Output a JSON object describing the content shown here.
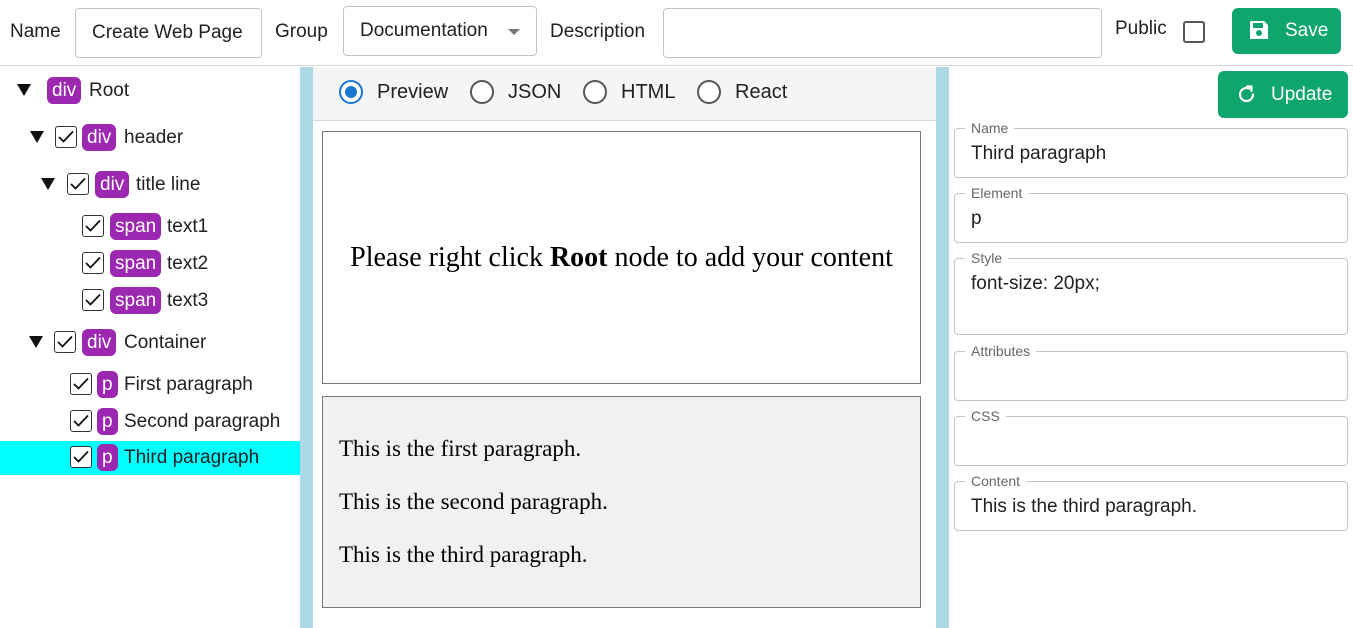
{
  "toolbar": {
    "name_label": "Name",
    "name_value": "Create Web Page",
    "group_label": "Group",
    "group_value": "Documentation",
    "description_label": "Description",
    "description_value": "",
    "public_label": "Public",
    "public_checked": false,
    "save_label": "Save"
  },
  "tree": {
    "nodes": [
      {
        "tag": "div",
        "label": "Root",
        "expanded": true,
        "checkbox": false
      },
      {
        "tag": "div",
        "label": "header",
        "expanded": true,
        "checked": true
      },
      {
        "tag": "div",
        "label": "title line",
        "expanded": true,
        "checked": true
      },
      {
        "tag": "span",
        "label": "text1",
        "checked": true
      },
      {
        "tag": "span",
        "label": "text2",
        "checked": true
      },
      {
        "tag": "span",
        "label": "text3",
        "checked": true
      },
      {
        "tag": "div",
        "label": "Container",
        "expanded": true,
        "checked": true
      },
      {
        "tag": "p",
        "label": "First paragraph",
        "checked": true
      },
      {
        "tag": "p",
        "label": "Second paragraph",
        "checked": true
      },
      {
        "tag": "p",
        "label": "Third paragraph",
        "checked": true,
        "selected": true
      }
    ]
  },
  "view_modes": {
    "options": [
      "Preview",
      "JSON",
      "HTML",
      "React"
    ],
    "selected": "Preview"
  },
  "preview": {
    "hint_before": "Please right click ",
    "hint_bold": "Root",
    "hint_after": " node to add your content",
    "paragraphs": [
      "This is the first paragraph.",
      "This is the second paragraph.",
      "This is the third paragraph."
    ]
  },
  "properties": {
    "update_label": "Update",
    "name_label": "Name",
    "name_value": "Third paragraph",
    "element_label": "Element",
    "element_value": "p",
    "style_label": "Style",
    "style_value": "font-size: 20px;",
    "attributes_label": "Attributes",
    "attributes_value": "",
    "css_label": "CSS",
    "css_value": "",
    "content_label": "Content",
    "content_value": "This is the third paragraph."
  },
  "colors": {
    "accent_green": "#0fa56f",
    "tag_purple": "#9c27b0",
    "selection_cyan": "#00ffff",
    "splitter_blue": "#add8e6",
    "radio_blue": "#1976d2"
  }
}
